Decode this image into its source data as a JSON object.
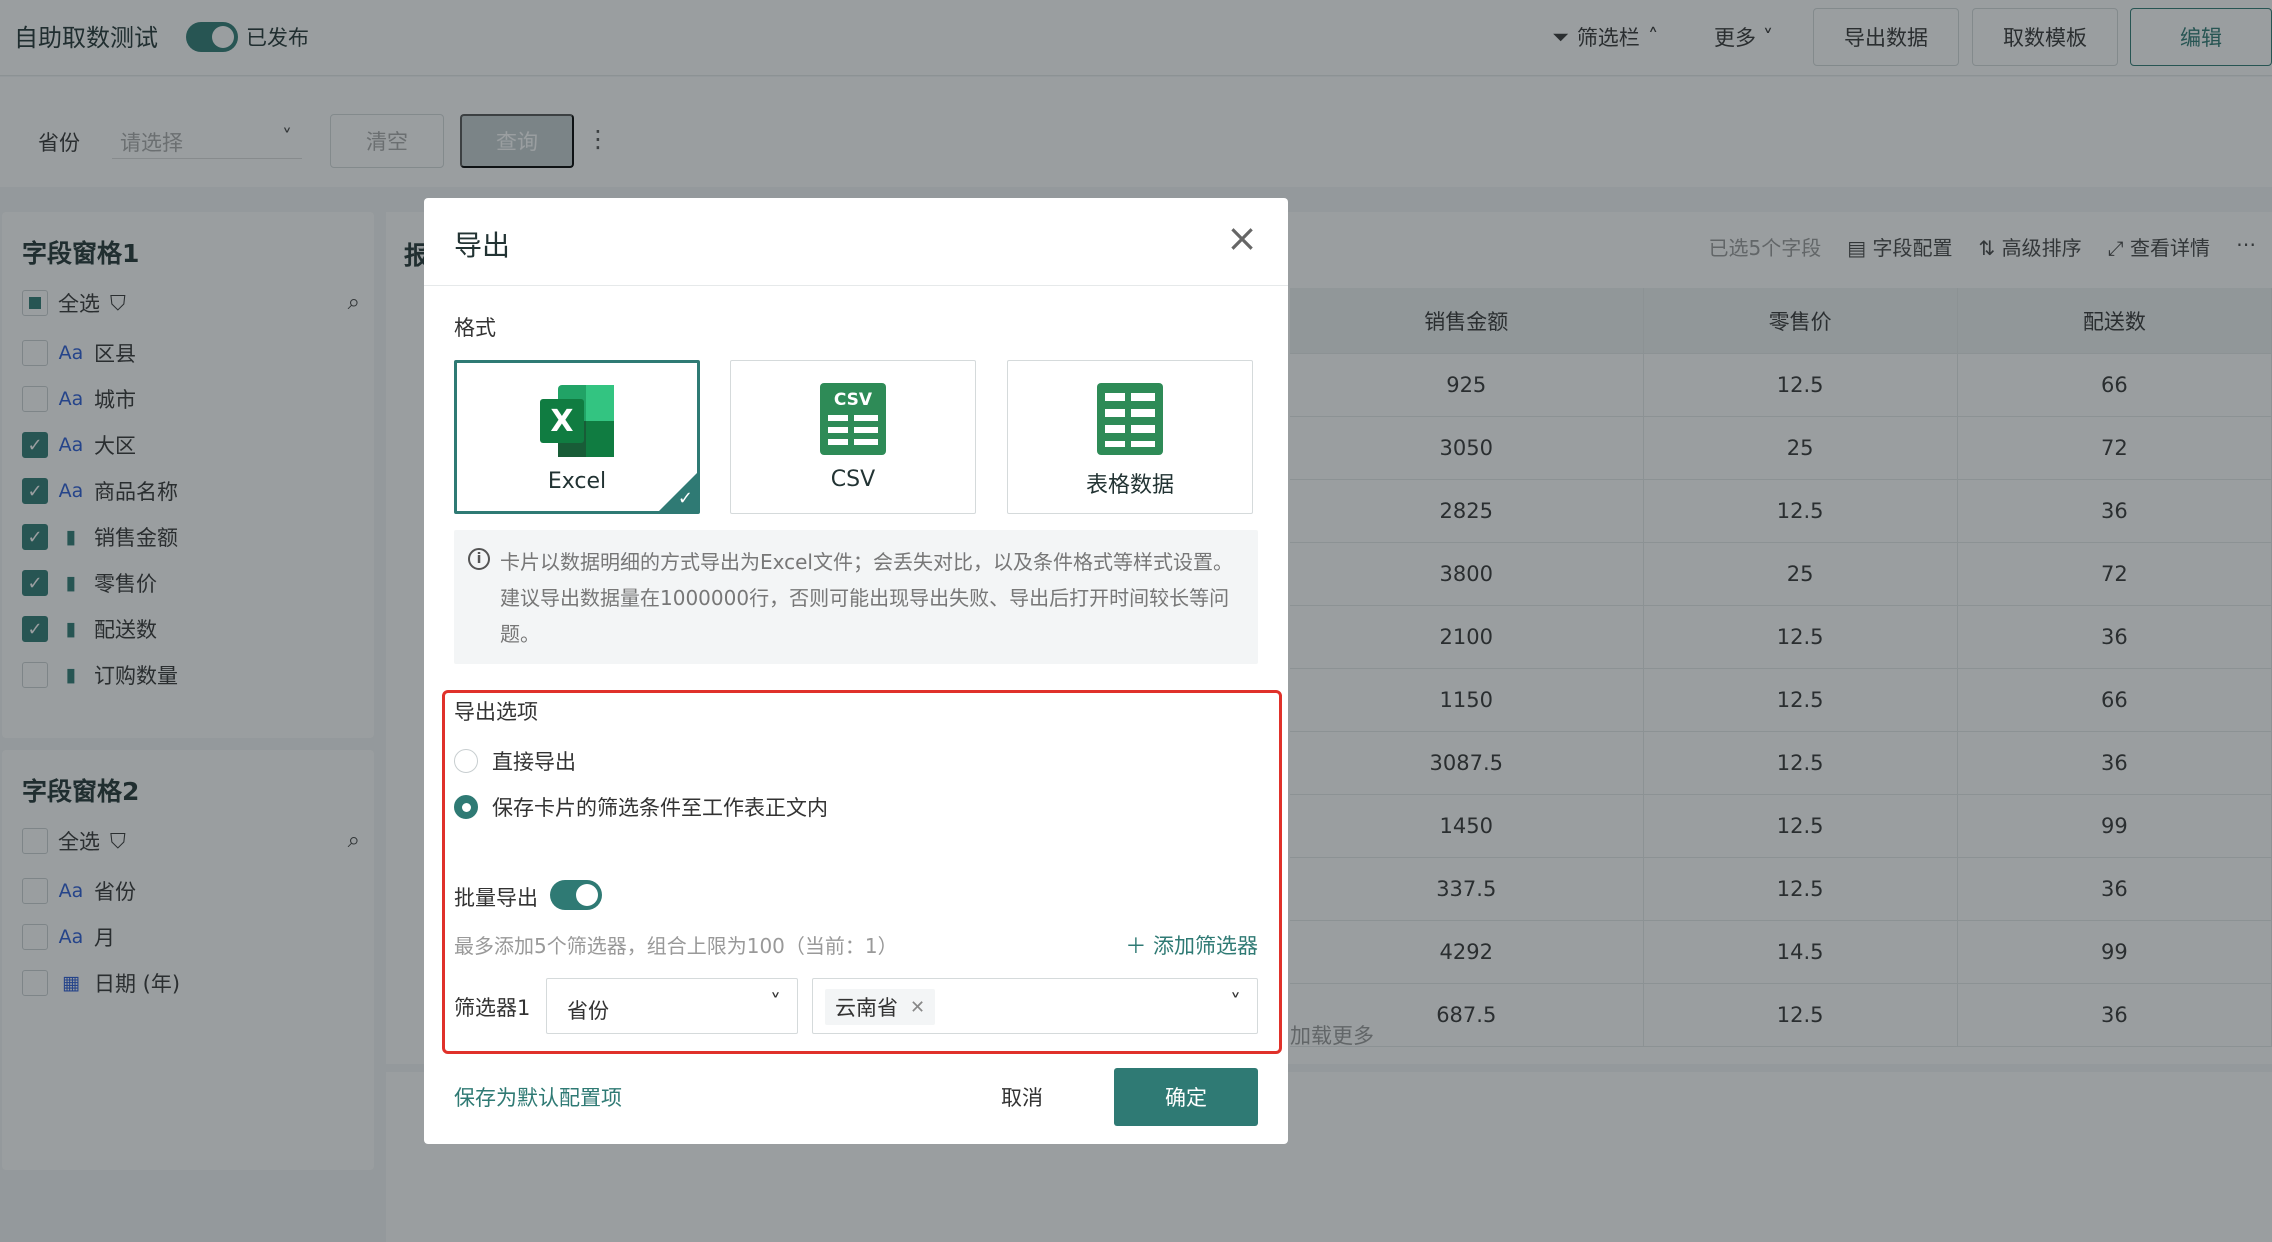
{
  "app": {
    "title": "自助取数测试",
    "published_label": "已发布",
    "filter_bar_toggle": "筛选栏",
    "more": "更多",
    "export_data": "导出数据",
    "fetch_template": "取数模板",
    "edit": "编辑"
  },
  "filter_bar": {
    "province_label": "省份",
    "province_placeholder": "请选择",
    "clear": "清空",
    "query": "查询"
  },
  "panel1": {
    "title": "字段窗格1",
    "select_all": "全选",
    "fields": [
      {
        "type": "Aa",
        "label": "区县",
        "checked": false
      },
      {
        "type": "Aa",
        "label": "城市",
        "checked": false
      },
      {
        "type": "Aa",
        "label": "大区",
        "checked": true
      },
      {
        "type": "Aa",
        "label": "商品名称",
        "checked": true
      },
      {
        "type": "measure",
        "label": "销售金额",
        "checked": true
      },
      {
        "type": "measure",
        "label": "零售价",
        "checked": true
      },
      {
        "type": "measure",
        "label": "配送数",
        "checked": true
      },
      {
        "type": "measure",
        "label": "订购数量",
        "checked": false
      }
    ]
  },
  "panel2": {
    "title": "字段窗格2",
    "select_all": "全选",
    "fields": [
      {
        "type": "Aa",
        "label": "省份"
      },
      {
        "type": "Aa",
        "label": "月"
      },
      {
        "type": "date",
        "label": "日期 (年)"
      }
    ]
  },
  "report": {
    "title": "报",
    "selected_count": "已选5个字段",
    "field_config": "字段配置",
    "advanced_sort": "高级排序",
    "view_detail": "查看详情",
    "columns": [
      "销售金额",
      "零售价",
      "配送数"
    ],
    "rows": [
      [
        "925",
        "12.5",
        "66"
      ],
      [
        "3050",
        "25",
        "72"
      ],
      [
        "2825",
        "12.5",
        "36"
      ],
      [
        "3800",
        "25",
        "72"
      ],
      [
        "2100",
        "12.5",
        "36"
      ],
      [
        "1150",
        "12.5",
        "66"
      ],
      [
        "3087.5",
        "12.5",
        "36"
      ],
      [
        "1450",
        "12.5",
        "99"
      ],
      [
        "337.5",
        "12.5",
        "36"
      ],
      [
        "4292",
        "14.5",
        "99"
      ],
      [
        "687.5",
        "12.5",
        "36"
      ]
    ],
    "load_more": "加载更多"
  },
  "dialog": {
    "title": "导出",
    "format_label": "格式",
    "formats": [
      {
        "label": "Excel",
        "selected": true
      },
      {
        "label": "CSV",
        "selected": false
      },
      {
        "label": "表格数据",
        "selected": false
      }
    ],
    "info": "卡片以数据明细的方式导出为Excel文件；会丢失对比，以及条件格式等样式设置。建议导出数据量在1000000行，否则可能出现导出失败、导出后打开时间较长等问题。",
    "export_options_label": "导出选项",
    "option_direct": "直接导出",
    "option_save_filter": "保存卡片的筛选条件至工作表正文内",
    "selected_option": "option_save_filter",
    "batch_export_label": "批量导出",
    "batch_export_on": true,
    "hint": "最多添加5个筛选器，组合上限为100（当前：1）",
    "add_filter": "添加筛选器",
    "filter1_label": "筛选器1",
    "filter1_field": "省份",
    "filter1_value": "云南省",
    "save_default": "保存为默认配置项",
    "cancel": "取消",
    "confirm": "确定"
  },
  "colors": {
    "accent": "#2f7a74",
    "highlight": "#e0312a"
  }
}
